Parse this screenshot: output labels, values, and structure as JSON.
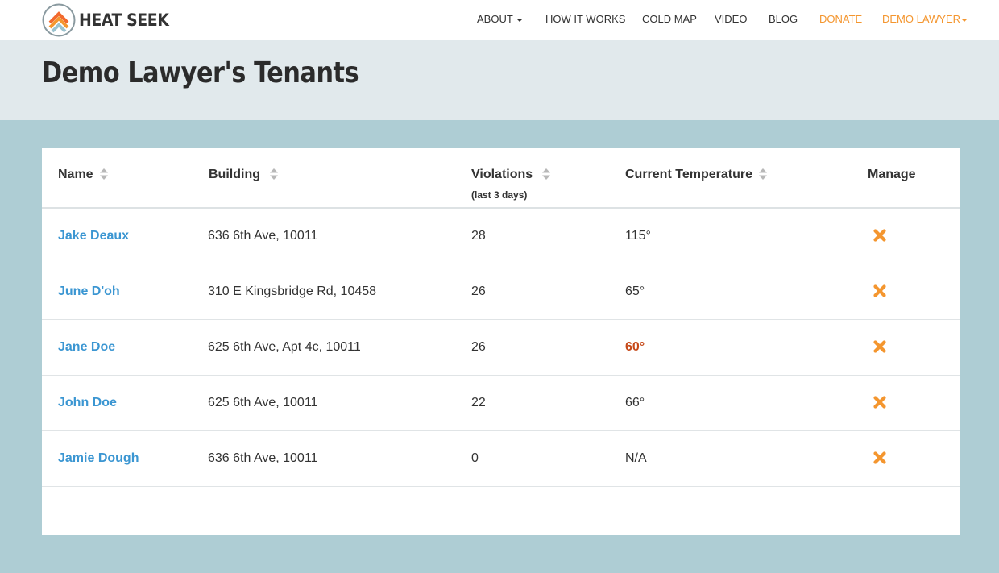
{
  "nav": {
    "brand": "HEAT SEEK",
    "items": [
      {
        "label": "ABOUT",
        "dropdown": true
      },
      {
        "label": "HOW IT WORKS"
      },
      {
        "label": "COLD MAP"
      },
      {
        "label": "VIDEO"
      },
      {
        "label": "BLOG"
      },
      {
        "label": "DONATE"
      },
      {
        "label": "DEMO LAWYER",
        "dropdown": true
      }
    ],
    "accent": "#f4962f"
  },
  "page": {
    "title": "Demo Lawyer's Tenants"
  },
  "table": {
    "columns": {
      "name": "Name",
      "building": "Building",
      "violations": "Violations",
      "violations_sub": "(last 3 days)",
      "temperature": "Current Temperature",
      "manage": "Manage"
    },
    "rows": [
      {
        "name": "Jake Deaux",
        "building": "636 6th Ave, 10011",
        "violations": "28",
        "temperature": "115°",
        "cold": false
      },
      {
        "name": "June D'oh",
        "building": "310 E Kingsbridge Rd, 10458",
        "violations": "26",
        "temperature": "65°",
        "cold": false
      },
      {
        "name": "Jane Doe",
        "building": "625 6th Ave, Apt 4c, 10011",
        "violations": "26",
        "temperature": "60°",
        "cold": true
      },
      {
        "name": "John Doe",
        "building": "625 6th Ave, 10011",
        "violations": "22",
        "temperature": "66°",
        "cold": false
      },
      {
        "name": "Jamie Dough",
        "building": "636 6th Ave, 10011",
        "violations": "0",
        "temperature": "N/A",
        "cold": false
      }
    ],
    "manage_icon": "delete-x-icon",
    "colors": {
      "link": "#3b96d2",
      "cold": "#c64919",
      "delete": "#f4962f"
    }
  }
}
